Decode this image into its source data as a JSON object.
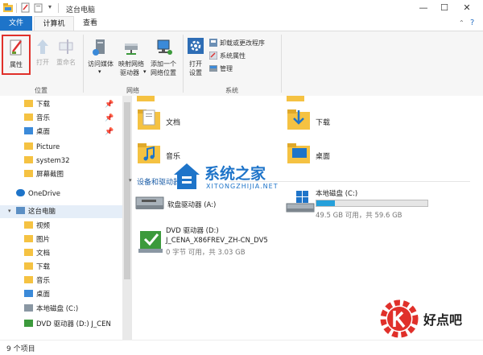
{
  "window": {
    "title": "这台电脑"
  },
  "tabs": [
    {
      "label": "文件"
    },
    {
      "label": "计算机"
    },
    {
      "label": "查看"
    }
  ],
  "ribbon": {
    "groups": {
      "location": "位置",
      "network": "网络",
      "system": "系统"
    },
    "buttons": {
      "properties": "属性",
      "open": "打开",
      "rename": "重命名",
      "access_media": "访问媒体",
      "map_drive_1": "映射网络",
      "map_drive_2": "驱动器",
      "add_location_1": "添加一个",
      "add_location_2": "网络位置",
      "open_settings_1": "打开",
      "open_settings_2": "设置",
      "uninstall": "卸载或更改程序",
      "sys_props": "系统属性",
      "manage": "管理"
    }
  },
  "nav": {
    "items": [
      {
        "label": "下载"
      },
      {
        "label": "音乐"
      },
      {
        "label": "桌面"
      },
      {
        "label": "Picture"
      },
      {
        "label": "system32"
      },
      {
        "label": "屏幕截图"
      },
      {
        "label": "OneDrive"
      },
      {
        "label": "这台电脑"
      },
      {
        "label": "视频"
      },
      {
        "label": "图片"
      },
      {
        "label": "文档"
      },
      {
        "label": "下载"
      },
      {
        "label": "音乐"
      },
      {
        "label": "桌面"
      },
      {
        "label": "本地磁盘 (C:)"
      },
      {
        "label": "DVD 驱动器 (D:) J_CEN"
      }
    ]
  },
  "content": {
    "folders": [
      {
        "label": "文档"
      },
      {
        "label": "下载"
      },
      {
        "label": "音乐"
      },
      {
        "label": "桌面"
      }
    ],
    "section_header": "设备和驱动器 (3)",
    "drives": {
      "floppy": {
        "label": "软盘驱动器 (A:)"
      },
      "local": {
        "label": "本地磁盘 (C:)",
        "sub": "49.5 GB 可用，共 59.6 GB",
        "used_fraction": 0.17
      },
      "dvd": {
        "label1": "DVD 驱动器 (D:)",
        "label2": "J_CENA_X86FREV_ZH-CN_DV5",
        "sub": "0 字节 可用，共 3.03 GB"
      }
    }
  },
  "status": {
    "text": "9 个项目"
  },
  "watermarks": {
    "w1_text": "系统之家",
    "w1_sub": "XITONGZHIJIA.NET",
    "w2_text": "好点吧"
  },
  "colors": {
    "accent": "#1e74c9",
    "folder": "#f5c242",
    "bar": "#26a0da",
    "highlight": "#e0302a"
  }
}
